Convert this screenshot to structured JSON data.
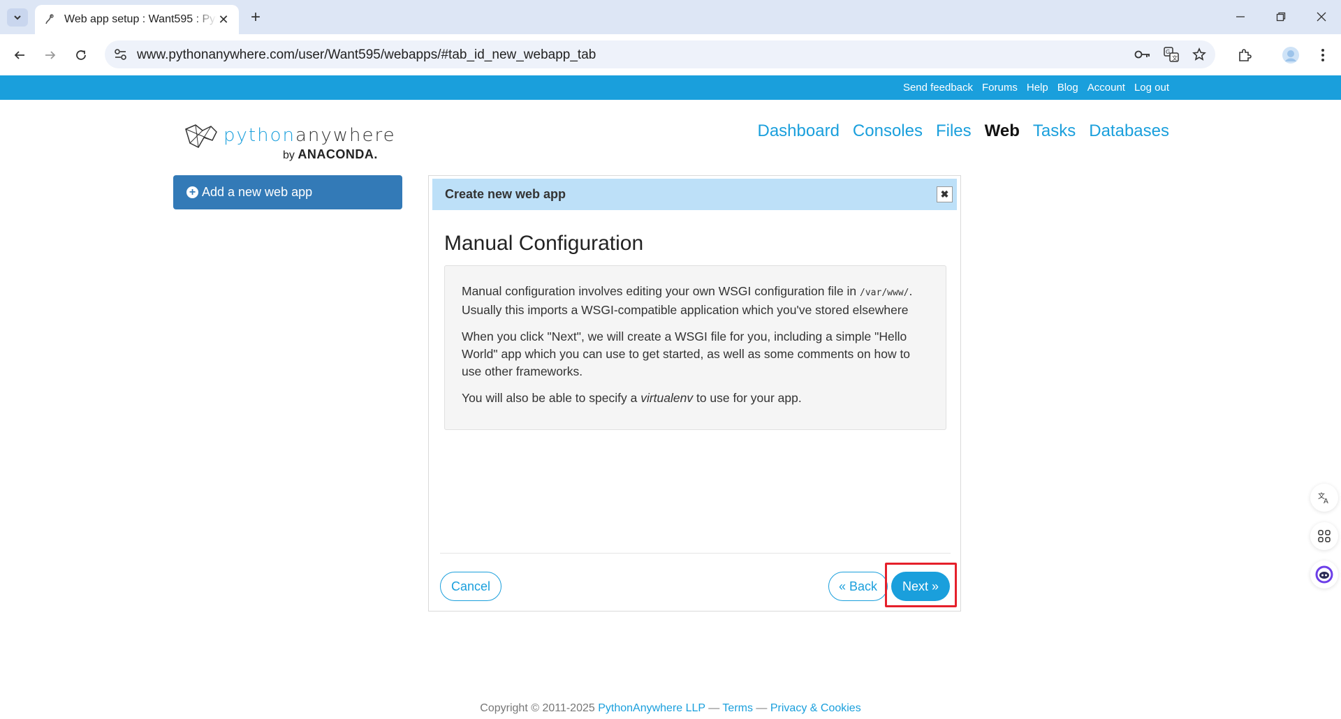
{
  "browser": {
    "tab_title": "Web app setup : Want595 : PythonAnywhere",
    "url": "www.pythonanywhere.com/user/Want595/webapps/#tab_id_new_webapp_tab",
    "new_tab_label": "+"
  },
  "top_links": [
    "Send feedback",
    "Forums",
    "Help",
    "Blog",
    "Account",
    "Log out"
  ],
  "logo": {
    "python": "python",
    "anywhere": "anywhere",
    "by": "by",
    "anaconda": "ANACONDA."
  },
  "nav": {
    "dashboard": "Dashboard",
    "consoles": "Consoles",
    "files": "Files",
    "web": "Web",
    "tasks": "Tasks",
    "databases": "Databases"
  },
  "sidebar": {
    "add_webapp": "Add a new web app"
  },
  "dialog": {
    "header": "Create new web app",
    "heading": "Manual Configuration",
    "p1_a": "Manual configuration involves editing your own WSGI configuration file in ",
    "p1_code": "/var/www/",
    "p1_b": ". Usually this imports a WSGI-compatible application which you've stored elsewhere",
    "p2": "When you click \"Next\", we will create a WSGI file for you, including a simple \"Hello World\" app which you can use to get started, as well as some comments on how to use other frameworks.",
    "p3_a": "You will also be able to specify a ",
    "p3_em": "virtualenv",
    "p3_b": " to use for your app.",
    "cancel": "Cancel",
    "back": "« Back",
    "next": "Next »"
  },
  "footer": {
    "copyright": "Copyright © 2011-2025 ",
    "company": "PythonAnywhere LLP",
    "sep1": " — ",
    "terms": "Terms",
    "sep2": " — ",
    "privacy": "Privacy & Cookies"
  },
  "colors": {
    "brand_blue": "#1a9fdc",
    "button_blue": "#337ab7",
    "dialog_header": "#bde0f8",
    "highlight_red": "#e5202b"
  }
}
